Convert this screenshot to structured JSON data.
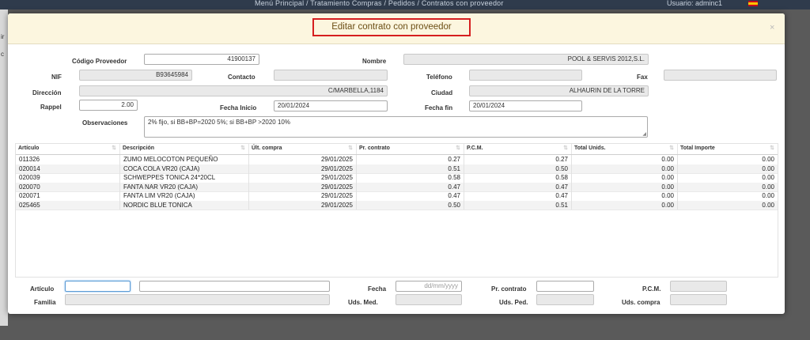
{
  "topbar": {
    "breadcrumb": "Menú Principal /  Tratamiento Compras / Pedidos /  Contratos con proveedor",
    "user": "Usuario: adminc1"
  },
  "left_strip": {
    "t1": "ir",
    "t2": "c"
  },
  "modal": {
    "title": "Editar contrato con proveedor",
    "close": "×"
  },
  "form": {
    "codigo_proveedor": {
      "label": "Código Proveedor",
      "value": "41900137"
    },
    "nombre": {
      "label": "Nombre",
      "value": "POOL & SERVIS 2012,S.L."
    },
    "nif": {
      "label": "NIF",
      "value": "B93645984"
    },
    "contacto": {
      "label": "Contacto",
      "value": ""
    },
    "telefono": {
      "label": "Teléfono",
      "value": ""
    },
    "fax": {
      "label": "Fax",
      "value": ""
    },
    "direccion": {
      "label": "Dirección",
      "value": "C/MARBELLA,1184"
    },
    "ciudad": {
      "label": "Ciudad",
      "value": "ALHAURIN DE LA TORRE"
    },
    "rappel": {
      "label": "Rappel",
      "value": "2.00"
    },
    "fecha_inicio": {
      "label": "Fecha Inicio",
      "value": "20/01/2024"
    },
    "fecha_fin": {
      "label": "Fecha fin",
      "value": "20/01/2024"
    },
    "observaciones": {
      "label": "Observaciones",
      "value": "2% fijo, si BB+BP=2020 5%; si BB+BP >2020 10%"
    }
  },
  "table": {
    "headers": [
      "Artículo",
      "Descripción",
      "Últ. compra",
      "Pr. contrato",
      "P.C.M.",
      "Total Unids.",
      "Total Importe"
    ],
    "sort_icon": "⇅",
    "rows": [
      [
        "011326",
        "ZUMO MELOCOTON PEQUEÑO",
        "29/01/2025",
        "0.27",
        "0.27",
        "0.00",
        "0.00"
      ],
      [
        "020014",
        "COCA COLA VR20 (CAJA)",
        "29/01/2025",
        "0.51",
        "0.50",
        "0.00",
        "0.00"
      ],
      [
        "020039",
        "SCHWEPPES TONICA 24*20CL",
        "29/01/2025",
        "0.58",
        "0.58",
        "0.00",
        "0.00"
      ],
      [
        "020070",
        "FANTA NAR VR20 (CAJA)",
        "29/01/2025",
        "0.47",
        "0.47",
        "0.00",
        "0.00"
      ],
      [
        "020071",
        "FANTA LIM VR20 (CAJA)",
        "29/01/2025",
        "0.47",
        "0.47",
        "0.00",
        "0.00"
      ],
      [
        "025465",
        "NORDIC BLUE TONICA",
        "29/01/2025",
        "0.50",
        "0.51",
        "0.00",
        "0.00"
      ]
    ]
  },
  "bottom": {
    "articulo": {
      "label": "Artículo",
      "value": "",
      "desc": ""
    },
    "familia": {
      "label": "Familia",
      "value": ""
    },
    "fecha": {
      "label": "Fecha",
      "placeholder": "dd/mm/yyyy"
    },
    "uds_med": {
      "label": "Uds. Med.",
      "value": ""
    },
    "pr_contrato": {
      "label": "Pr. contrato",
      "value": ""
    },
    "uds_ped": {
      "label": "Uds. Ped.",
      "value": ""
    },
    "pcm": {
      "label": "P.C.M.",
      "value": ""
    },
    "uds_compra": {
      "label": "Uds. compra",
      "value": ""
    }
  },
  "colors": {
    "header_bg": "#fcf6df",
    "title_border": "#d61f1f",
    "title_text": "#6b4e14",
    "topbar_bg": "#2f3b4c"
  }
}
